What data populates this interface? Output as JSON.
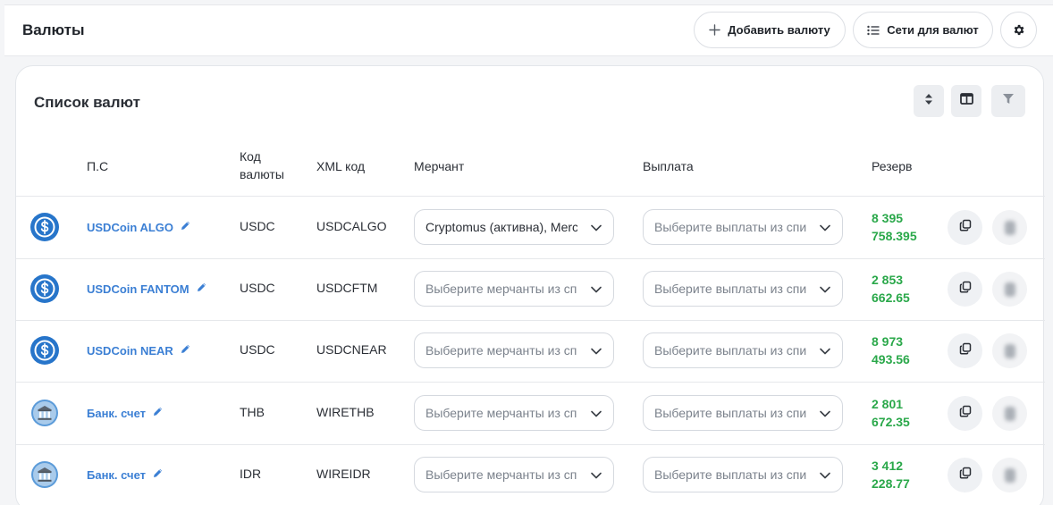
{
  "header": {
    "title": "Валюты",
    "add_label": "Добавить валюту",
    "networks_label": "Сети для валют"
  },
  "card": {
    "title": "Список валют"
  },
  "columns": {
    "ps": "П.С",
    "code_line1": "Код",
    "code_line2": "валюты",
    "xml": "XML код",
    "merchant": "Мерчант",
    "payout": "Выплата",
    "reserve": "Резерв"
  },
  "rows": [
    {
      "icon": "usdc-coin-icon",
      "name": "USDCoin ALGO",
      "code": "USDC",
      "xml": "USDCALGO",
      "merchant": "Cryptomus (активна), Merchant",
      "merchant_filled": true,
      "payout": "Выберите выплаты из списка",
      "reserve_line1": "8 395",
      "reserve_line2": "758.395"
    },
    {
      "icon": "usdc-coin-icon",
      "name": "USDCoin FANTOM",
      "code": "USDC",
      "xml": "USDCFTM",
      "merchant": "Выберите мерчанты из списка",
      "merchant_filled": false,
      "payout": "Выберите выплаты из списка",
      "reserve_line1": "2 853",
      "reserve_line2": "662.65"
    },
    {
      "icon": "usdc-coin-icon",
      "name": "USDCoin NEAR",
      "code": "USDC",
      "xml": "USDCNEAR",
      "merchant": "Выберите мерчанты из списка",
      "merchant_filled": false,
      "payout": "Выберите выплаты из списка",
      "reserve_line1": "8 973",
      "reserve_line2": "493.56"
    },
    {
      "icon": "bank-icon",
      "name": "Банк. счет",
      "code": "THB",
      "xml": "WIRETHB",
      "merchant": "Выберите мерчанты из списка",
      "merchant_filled": false,
      "payout": "Выберите выплаты из списка",
      "reserve_line1": "2 801",
      "reserve_line2": "672.35"
    },
    {
      "icon": "bank-icon",
      "name": "Банк. счет",
      "code": "IDR",
      "xml": "WIREIDR",
      "merchant": "Выберите мерчанты из списка",
      "merchant_filled": false,
      "payout": "Выберите выплаты из списка",
      "reserve_line1": "3 412",
      "reserve_line2": "228.77"
    }
  ],
  "colors": {
    "link": "#3b7fd4",
    "reserve": "#2aa84a",
    "usdc": "#2775ca"
  }
}
